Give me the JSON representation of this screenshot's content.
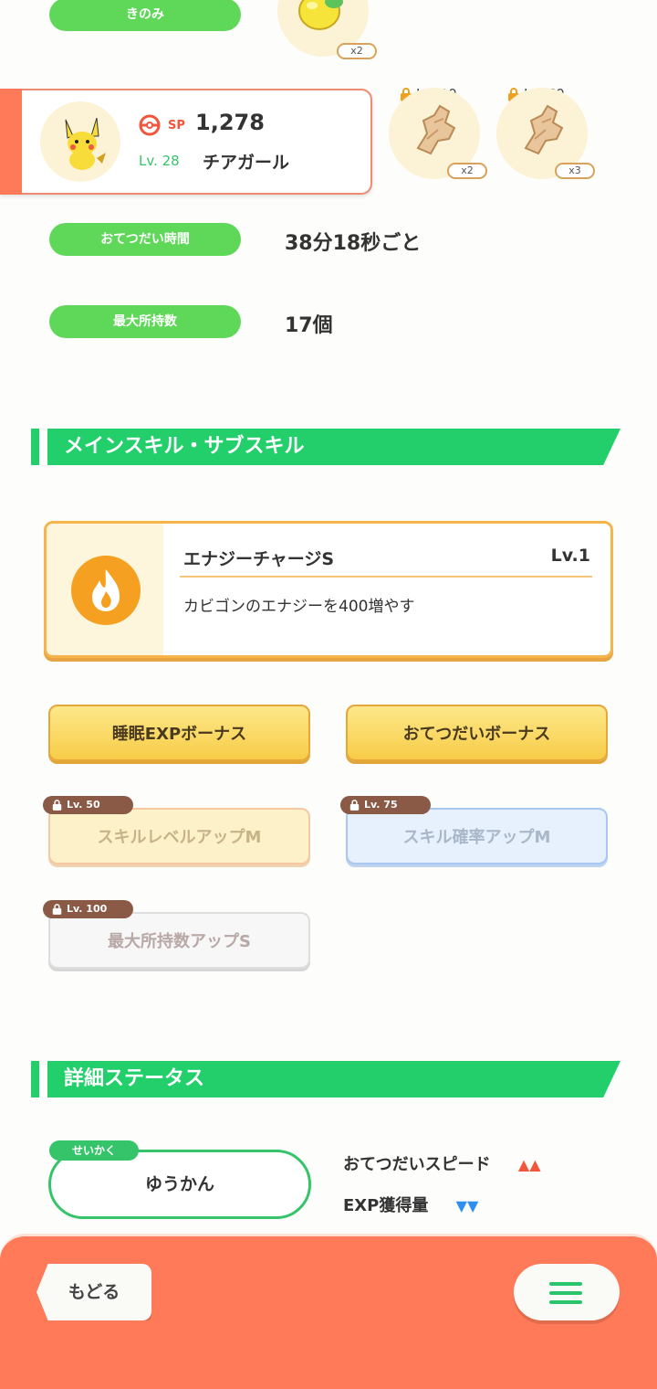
{
  "berry": {
    "label": "きのみ",
    "quantity": "x2"
  },
  "pokemon_card": {
    "sp_label": "SP",
    "sp_value": "1,278",
    "level": "Lv. 28",
    "subskill": "チアガール"
  },
  "ingredients": [
    {
      "lock_level": "Lv. 30",
      "quantity": "x2"
    },
    {
      "lock_level": "Lv. 60",
      "quantity": "x3"
    }
  ],
  "stats": [
    {
      "label": "おてつだい時間",
      "value": "38分18秒ごと"
    },
    {
      "label": "最大所持数",
      "value": "17個"
    }
  ],
  "skills_section": {
    "title": "メインスキル・サブスキル",
    "main_skill": {
      "name": "エナジーチャージS",
      "level": "Lv.1",
      "description": "カビゴンのエナジーを400増やす"
    },
    "sub_skills": [
      {
        "label": "睡眠EXPボーナス",
        "lock": ""
      },
      {
        "label": "おてつだいボーナス",
        "lock": ""
      },
      {
        "label": "スキルレベルアップM",
        "lock": "Lv. 50"
      },
      {
        "label": "スキル確率アップM",
        "lock": "Lv. 75"
      },
      {
        "label": "最大所持数アップS",
        "lock": "Lv. 100"
      }
    ]
  },
  "details_section": {
    "title": "詳細ステータス",
    "nature_tag": "せいかく",
    "nature": "ゆうかん",
    "effects": [
      {
        "label": "おてつだいスピード",
        "arrows": "▲▲",
        "color": "#f2553c"
      },
      {
        "label": "EXP獲得量",
        "arrows": "▼▼",
        "color": "#2f8fef"
      }
    ]
  },
  "bottom_bar": {
    "back_label": "もどる",
    "menu_icon": "hamburger-menu-icon",
    "color": "#ff7a58"
  },
  "colors": {
    "accent_green": "#22cf6a",
    "pill_green": "#5fd85a",
    "skill_orange": "#f5a020",
    "subskill_yellow": "#f7cc47"
  }
}
